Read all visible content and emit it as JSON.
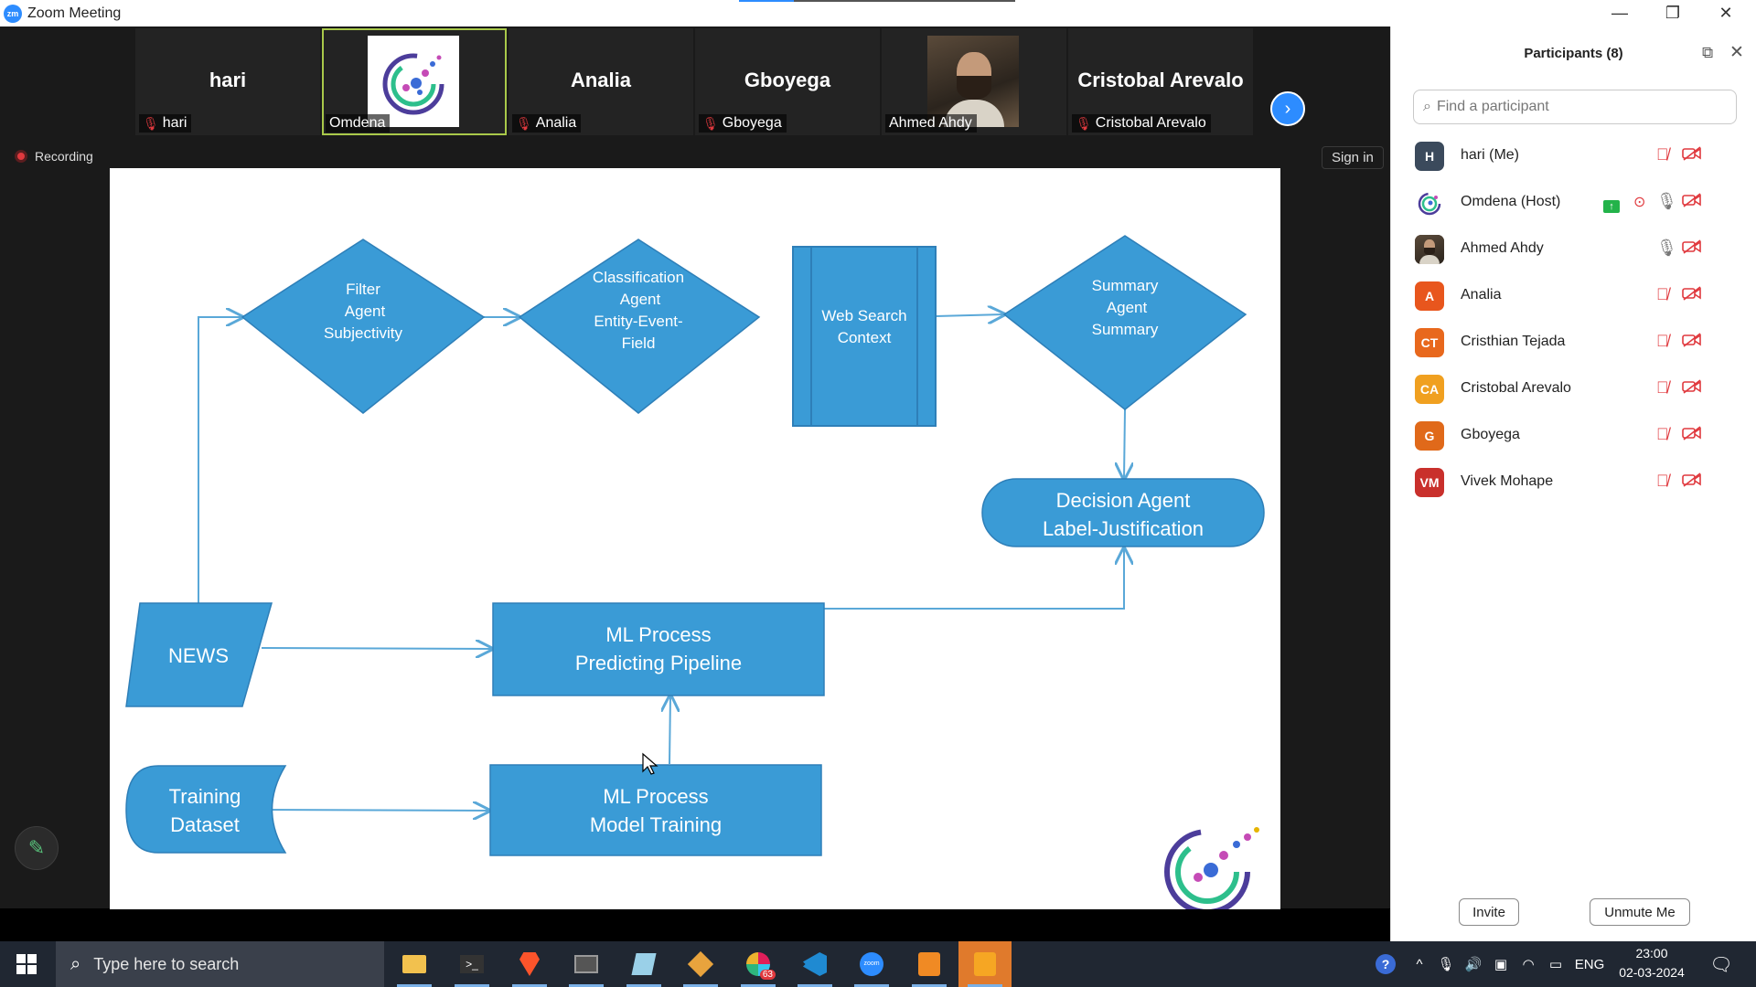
{
  "window": {
    "title": "Zoom Meeting",
    "minimize_glyph": "—",
    "restore_glyph": "❐",
    "close_glyph": "✕"
  },
  "thumbnails": [
    {
      "big_name": "hari",
      "label": "hari",
      "muted": true,
      "kind": "name"
    },
    {
      "big_name": "",
      "label": "Omdena",
      "muted": false,
      "kind": "logo",
      "active": true
    },
    {
      "big_name": "Analia",
      "label": "Analia",
      "muted": true,
      "kind": "name"
    },
    {
      "big_name": "Gboyega",
      "label": "Gboyega",
      "muted": true,
      "kind": "name"
    },
    {
      "big_name": "",
      "label": "Ahmed Ahdy",
      "muted": false,
      "kind": "photo"
    },
    {
      "big_name": "Cristobal Arevalo",
      "label": "Cristobal Arevalo",
      "muted": true,
      "kind": "name"
    }
  ],
  "recording_label": "Recording",
  "sign_in_label": "Sign in",
  "diagram": {
    "filter_agent": [
      "Filter",
      "Agent",
      "Subjectivity"
    ],
    "classification_agent": [
      "Classification",
      "Agent",
      "Entity-Event-",
      "Field"
    ],
    "web_search": [
      "Web Search",
      "Context"
    ],
    "summary_agent": [
      "Summary",
      "Agent",
      "Summary"
    ],
    "decision_agent": [
      "Decision Agent",
      "Label-Justification"
    ],
    "news": "NEWS",
    "ml_predict": [
      "ML Process",
      "Predicting Pipeline"
    ],
    "training_dataset": [
      "Training",
      "Dataset"
    ],
    "ml_training": [
      "ML Process",
      "Model Training"
    ]
  },
  "colors": {
    "shape_fill": "#3A9BD6",
    "shape_stroke": "#2E7FB8",
    "zoom_blue": "#2D8CFF",
    "mute_red": "#E0393E",
    "taskbar": "#202732"
  },
  "participants_panel": {
    "title": "Participants (8)",
    "search_placeholder": "Find a participant",
    "invite_label": "Invite",
    "unmute_label": "Unmute Me",
    "participants": [
      {
        "name": "hari (Me)",
        "initials": "H",
        "color": "#3b4a5c",
        "mic": "muted",
        "video": "off"
      },
      {
        "name": "Omdena (Host)",
        "initials": "",
        "color": "#ffffff",
        "mic": "on",
        "video": "off",
        "sharing": true,
        "recording": true,
        "avatar": "logo"
      },
      {
        "name": "Ahmed Ahdy",
        "initials": "",
        "color": "#4a3a2c",
        "mic": "on",
        "video": "off",
        "avatar": "photo"
      },
      {
        "name": "Analia",
        "initials": "A",
        "color": "#e8561d",
        "mic": "muted",
        "video": "off"
      },
      {
        "name": "Cristhian Tejada",
        "initials": "CT",
        "color": "#e8681d",
        "mic": "muted",
        "video": "off"
      },
      {
        "name": "Cristobal Arevalo",
        "initials": "CA",
        "color": "#f0a020",
        "mic": "muted",
        "video": "off"
      },
      {
        "name": "Gboyega",
        "initials": "G",
        "color": "#e0691a",
        "mic": "muted",
        "video": "off"
      },
      {
        "name": "Vivek Mohape",
        "initials": "VM",
        "color": "#c9302c",
        "mic": "muted",
        "video": "off"
      }
    ]
  },
  "taskbar": {
    "search_placeholder": "Type here to search",
    "apps": [
      "file-explorer-icon",
      "terminal-icon",
      "brave-icon",
      "window-icon",
      "notepad-icon",
      "git-icon",
      "slack-icon",
      "vscode-icon",
      "zoom-icon",
      "ppt-icon",
      "slides-icon"
    ],
    "slack_badge": "63",
    "language": "ENG",
    "time": "23:00",
    "date": "02-03-2024"
  }
}
